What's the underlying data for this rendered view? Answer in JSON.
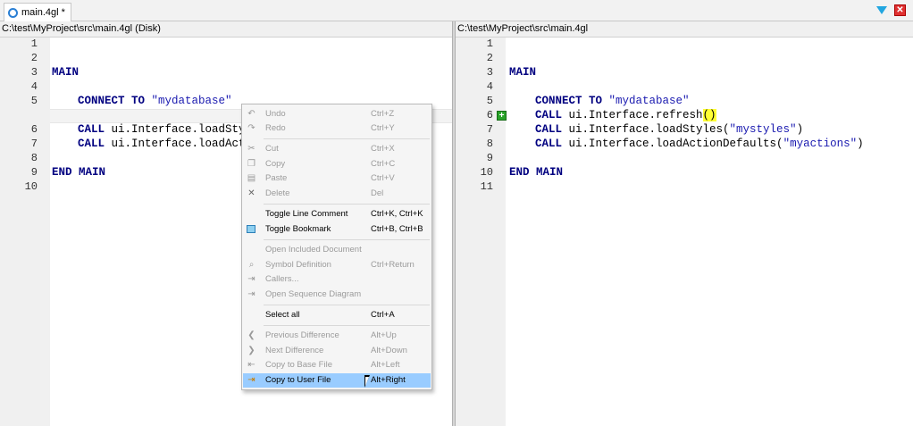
{
  "tab": {
    "title": "main.4gl *",
    "icon": "gear-file-icon"
  },
  "window_buttons": {
    "menu_icon": "dropdown-triangle-icon",
    "close_icon": "close-icon",
    "close_glyph": "✕"
  },
  "left_pane": {
    "header": "C:\\test\\MyProject\\src\\main.4gl (Disk)",
    "line_numbers": [
      "1",
      "2",
      "3",
      "4",
      "5",
      "6",
      "7",
      "8",
      "9",
      "10"
    ]
  },
  "right_pane": {
    "header": "C:\\test\\MyProject\\src\\main.4gl",
    "line_numbers": [
      "1",
      "2",
      "3",
      "4",
      "5",
      "6",
      "7",
      "8",
      "9",
      "10",
      "11"
    ],
    "added_marker": "+"
  },
  "code": {
    "main": "MAIN",
    "connect_kw": "CONNECT TO",
    "connect_str": "\"mydatabase\"",
    "call_kw": "CALL",
    "left_call1": " ui.Interface.loadSty",
    "left_call2": " ui.Interface.loadAct",
    "refresh_prefix": " ui.Interface.refresh",
    "refresh_paren": "()",
    "load_styles_prefix": " ui.Interface.loadStyles(",
    "load_styles_str": "\"mystyles\"",
    "load_styles_suffix": ")",
    "load_actions_prefix": " ui.Interface.loadActionDefaults(",
    "load_actions_str": "\"myactions\"",
    "load_actions_suffix": ")",
    "end_main": "END MAIN"
  },
  "context_menu": {
    "items": [
      {
        "label": "Undo",
        "shortcut": "Ctrl+Z",
        "icon": "undo-icon",
        "glyph": "↶",
        "enabled": false
      },
      {
        "label": "Redo",
        "shortcut": "Ctrl+Y",
        "icon": "redo-icon",
        "glyph": "↷",
        "enabled": false
      },
      {
        "label": "Cut",
        "shortcut": "Ctrl+X",
        "icon": "cut-icon",
        "glyph": "✂",
        "enabled": false
      },
      {
        "label": "Copy",
        "shortcut": "Ctrl+C",
        "icon": "copy-icon",
        "glyph": "❐",
        "enabled": false
      },
      {
        "label": "Paste",
        "shortcut": "Ctrl+V",
        "icon": "paste-icon",
        "glyph": "▤",
        "enabled": false
      },
      {
        "label": "Delete",
        "shortcut": "Del",
        "icon": "delete-icon",
        "glyph": "✕",
        "enabled": false
      },
      {
        "label": "Toggle Line Comment",
        "shortcut": "Ctrl+K, Ctrl+K",
        "icon": "",
        "glyph": "",
        "enabled": true
      },
      {
        "label": "Toggle Bookmark",
        "shortcut": "Ctrl+B, Ctrl+B",
        "icon": "bookmark-icon",
        "glyph": "▭",
        "enabled": true
      },
      {
        "label": "Open Included Document",
        "shortcut": "",
        "icon": "",
        "glyph": "",
        "enabled": false
      },
      {
        "label": "Symbol Definition",
        "shortcut": "Ctrl+Return",
        "icon": "symbol-definition-icon",
        "glyph": "⌕",
        "enabled": false
      },
      {
        "label": "Callers...",
        "shortcut": "",
        "icon": "callers-icon",
        "glyph": "⇥",
        "enabled": false
      },
      {
        "label": "Open Sequence Diagram",
        "shortcut": "",
        "icon": "sequence-diagram-icon",
        "glyph": "⇥",
        "enabled": false
      },
      {
        "label": "Select all",
        "shortcut": "Ctrl+A",
        "icon": "",
        "glyph": "",
        "enabled": true
      },
      {
        "label": "Previous Difference",
        "shortcut": "Alt+Up",
        "icon": "previous-difference-icon",
        "glyph": "❮",
        "enabled": false
      },
      {
        "label": "Next Difference",
        "shortcut": "Alt+Down",
        "icon": "next-difference-icon",
        "glyph": "❯",
        "enabled": false
      },
      {
        "label": "Copy to Base File",
        "shortcut": "Alt+Left",
        "icon": "copy-to-base-icon",
        "glyph": "⇤",
        "enabled": false
      },
      {
        "label": "Copy to User File",
        "shortcut": "Alt+Right",
        "icon": "copy-to-user-icon",
        "glyph": "⇥",
        "enabled": true,
        "highlighted": true
      }
    ]
  },
  "colors": {
    "selection": "#99ccff",
    "keyword": "#000080",
    "string": "#1a1ab0",
    "added_marker": "#28a228",
    "highlight": "#ffff33"
  }
}
